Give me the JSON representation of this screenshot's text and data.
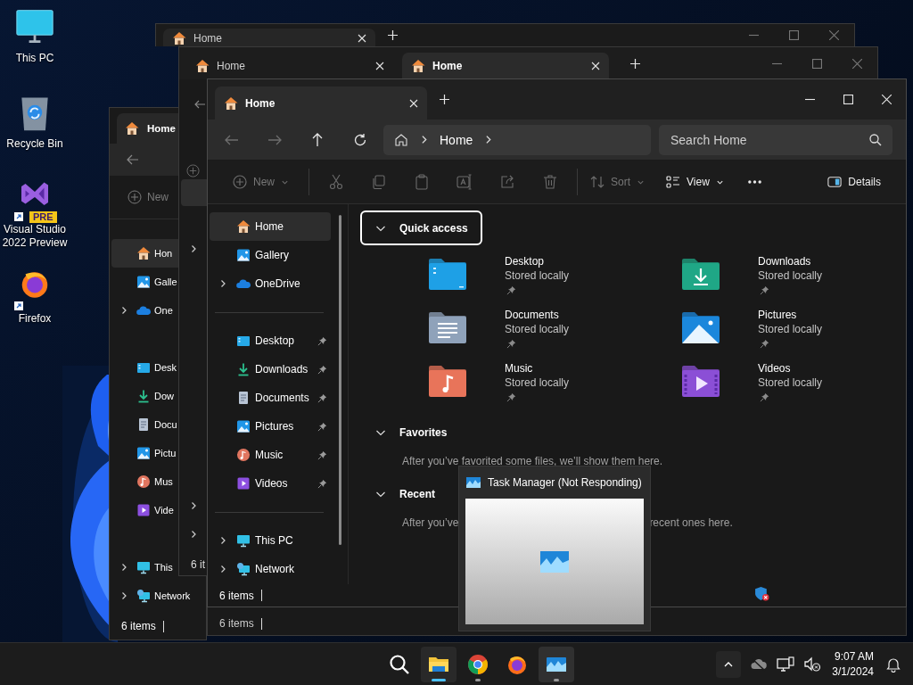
{
  "desktop_icons": [
    {
      "label": "This PC",
      "shortcut": false
    },
    {
      "label": "Recycle Bin",
      "shortcut": false
    },
    {
      "label": "Visual Studio 2022 Preview",
      "badge": "PRE",
      "shortcut": true
    },
    {
      "label": "Firefox",
      "shortcut": true
    }
  ],
  "window_top": {
    "tab": "Home"
  },
  "window_middle": {
    "tabs": [
      {
        "label": "Home",
        "selected": false
      },
      {
        "label": "Home",
        "selected": true
      }
    ],
    "status": "6 it"
  },
  "window_left": {
    "tab": "Home",
    "new_label": "New",
    "nav_items": [
      {
        "label": "Hon",
        "selected": true,
        "expandable": false
      },
      {
        "label": "Galle",
        "selected": false,
        "expandable": false
      },
      {
        "label": "One",
        "selected": false,
        "expandable": true
      },
      {
        "label": "Desk",
        "selected": false,
        "expandable": false
      },
      {
        "label": "Dow",
        "selected": false,
        "expandable": false
      },
      {
        "label": "Docu",
        "selected": false,
        "expandable": false
      },
      {
        "label": "Pictu",
        "selected": false,
        "expandable": false
      },
      {
        "label": "Mus",
        "selected": false,
        "expandable": false
      },
      {
        "label": "Vide",
        "selected": false,
        "expandable": false
      },
      {
        "label": "This",
        "selected": false,
        "expandable": true
      },
      {
        "label": "Network",
        "selected": false,
        "expandable": true
      }
    ],
    "status": "6 items"
  },
  "window_lower": {
    "status": "6 items"
  },
  "explorer": {
    "tab": "Home",
    "nav_buttons": [
      {
        "disabled": true
      },
      {
        "disabled": true
      },
      {
        "disabled": false
      },
      {
        "disabled": false
      }
    ],
    "breadcrumb": "Home",
    "search": {
      "placeholder": "Search Home"
    },
    "commands": [
      {
        "label": "New",
        "disabled": true
      },
      {
        "disabled": true
      },
      {
        "disabled": true
      },
      {
        "disabled": true
      },
      {
        "disabled": true
      },
      {
        "disabled": true
      },
      {
        "disabled": true
      },
      {
        "label": "Sort",
        "disabled": true
      },
      {
        "label": "View",
        "disabled": false
      },
      {
        "disabled": false
      }
    ],
    "details_button": "Details",
    "sidebar": {
      "sections": [
        {
          "items": [
            {
              "label": "Home",
              "selected": true,
              "expandable": false,
              "pinned": false
            },
            {
              "label": "Gallery",
              "selected": false,
              "expandable": false,
              "pinned": false
            },
            {
              "label": "OneDrive",
              "selected": false,
              "expandable": true,
              "pinned": false
            }
          ]
        },
        {
          "items": [
            {
              "label": "Desktop",
              "selected": false,
              "expandable": false,
              "pinned": true
            },
            {
              "label": "Downloads",
              "selected": false,
              "expandable": false,
              "pinned": true
            },
            {
              "label": "Documents",
              "selected": false,
              "expandable": false,
              "pinned": true
            },
            {
              "label": "Pictures",
              "selected": false,
              "expandable": false,
              "pinned": true
            },
            {
              "label": "Music",
              "selected": false,
              "expandable": false,
              "pinned": true
            },
            {
              "label": "Videos",
              "selected": false,
              "expandable": false,
              "pinned": true
            }
          ]
        },
        {
          "items": [
            {
              "label": "This PC",
              "selected": false,
              "expandable": true,
              "pinned": false
            },
            {
              "label": "Network",
              "selected": false,
              "expandable": true,
              "pinned": false
            }
          ]
        }
      ]
    },
    "sections": [
      {
        "title": "Quick access",
        "expanded": true,
        "focused": true,
        "folders": [
          {
            "name": "Desktop",
            "status": "Stored locally",
            "pinned": true
          },
          {
            "name": "Downloads",
            "status": "Stored locally",
            "pinned": true
          },
          {
            "name": "Documents",
            "status": "Stored locally",
            "pinned": true
          },
          {
            "name": "Pictures",
            "status": "Stored locally",
            "pinned": true
          },
          {
            "name": "Music",
            "status": "Stored locally",
            "pinned": true
          },
          {
            "name": "Videos",
            "status": "Stored locally",
            "pinned": true
          }
        ]
      },
      {
        "title": "Favorites",
        "expanded": true,
        "focused": false,
        "message_parts": [
          "After you’ve favorited some files, we’ll show them here."
        ]
      },
      {
        "title": "Recent",
        "expanded": true,
        "focused": false,
        "message_parts": [
          "After you’ve",
          "recent ones here."
        ]
      }
    ],
    "status": "6 items"
  },
  "task_preview": {
    "title": "Task Manager (Not Responding)"
  },
  "taskbar": {
    "apps": [
      {
        "running": true,
        "active": true,
        "hovered": false
      },
      {
        "running": true,
        "active": false,
        "hovered": false
      },
      {
        "running": false,
        "active": false,
        "hovered": false
      },
      {
        "running": true,
        "active": false,
        "hovered": true
      }
    ],
    "time": "9:07 AM",
    "date": "3/1/2024"
  }
}
